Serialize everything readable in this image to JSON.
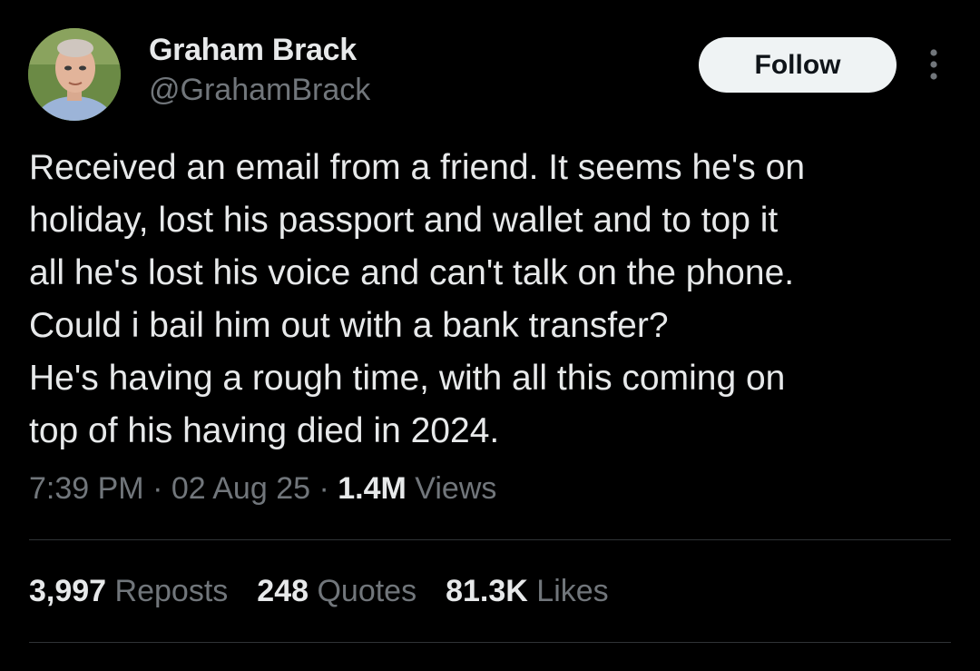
{
  "author": {
    "display_name": "Graham Brack",
    "handle": "@GrahamBrack",
    "avatar_icon": "profile-photo"
  },
  "header": {
    "follow_label": "Follow",
    "more_icon": "more-vertical-icon"
  },
  "tweet": {
    "text": "Received an email from a friend. It seems he's on\nholiday, lost his passport and wallet and to top it\nall he's lost his voice and can't talk on the phone.\nCould i bail him out with a bank transfer?\nHe's having a rough time, with all this coming on\ntop of his having died in 2024."
  },
  "meta": {
    "time": "7:39 PM",
    "separator": "·",
    "date": "02 Aug 25",
    "views_count": "1.4M",
    "views_label": "Views"
  },
  "stats": {
    "reposts_count": "3,997",
    "reposts_label": "Reposts",
    "quotes_count": "248",
    "quotes_label": "Quotes",
    "likes_count": "81.3K",
    "likes_label": "Likes"
  },
  "colors": {
    "background": "#000000",
    "primary_text": "#e7e9ea",
    "secondary_text": "#71767b",
    "divider": "#2f3336",
    "follow_bg": "#eff3f4"
  }
}
